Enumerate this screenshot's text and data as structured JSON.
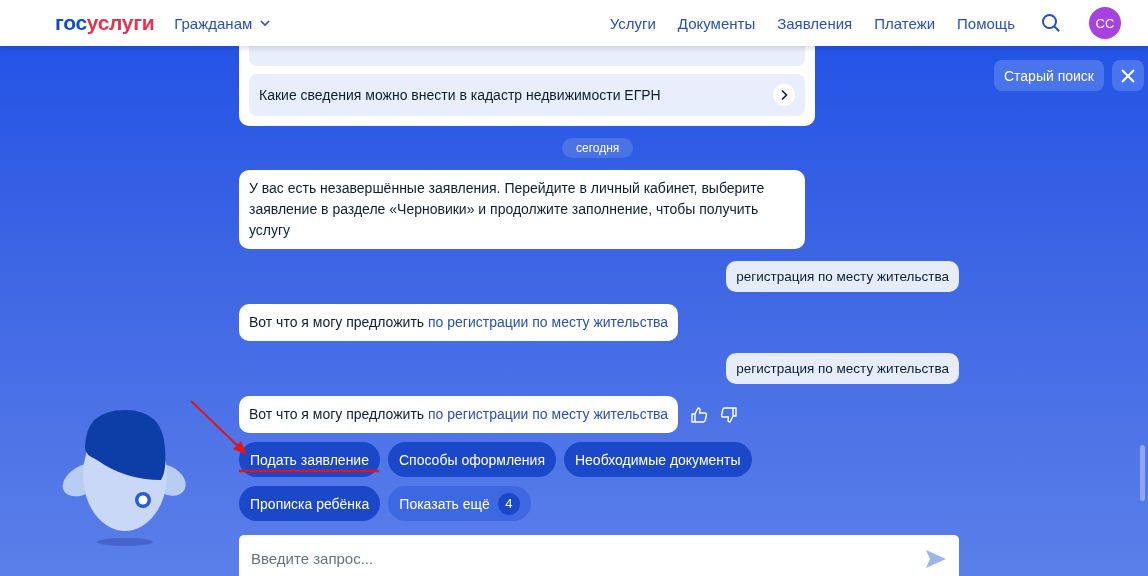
{
  "header": {
    "logo": {
      "part_1": "гос",
      "part_2": "услуги"
    },
    "audience_menu": "Гражданам",
    "nav": [
      "Услуги",
      "Документы",
      "Заявления",
      "Платежи",
      "Помощь"
    ],
    "avatar": "СС"
  },
  "side_button": "Старый поиск",
  "messages": [
    {
      "kind": "suggestions",
      "items": [
        "Какие сведения можно внести в кадастр недвижимости ЕГРН"
      ]
    },
    {
      "kind": "date",
      "text": "сегодня"
    },
    {
      "kind": "bot",
      "text": "У вас есть незавершённые заявления. Перейдите в личный кабинет, выберите заявление в разделе «Черновики» и продолжите заполнение, чтобы получить услугу",
      "feedback": false
    },
    {
      "kind": "user",
      "text": "регистрация по месту жительства"
    },
    {
      "kind": "bot",
      "text": "Вот что я могу предложить",
      "link": "по регистрации по месту жительства",
      "feedback": false
    },
    {
      "kind": "user",
      "text": "регистрация по месту жительства"
    },
    {
      "kind": "bot",
      "text": "Вот что я могу предложить",
      "link": "по регистрации по месту жительства",
      "feedback": true
    }
  ],
  "chips": [
    {
      "kind": "action",
      "label": "Подать заявление"
    },
    {
      "kind": "action",
      "label": "Способы оформления"
    },
    {
      "kind": "action",
      "label": "Необходимые документы"
    },
    {
      "kind": "action",
      "label": "Прописка ребёнка"
    },
    {
      "kind": "more",
      "label": "Показать ещё",
      "count": "4"
    }
  ],
  "input": {
    "placeholder": "Введите запрос..."
  }
}
